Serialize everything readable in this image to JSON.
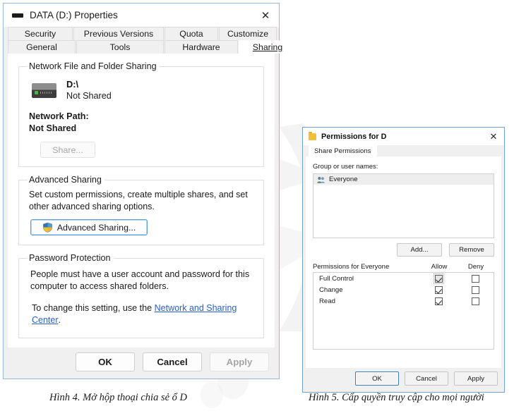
{
  "properties_dialog": {
    "title": "DATA (D:) Properties",
    "icon": "hard-drive-icon",
    "close_label": "✕",
    "tabs_row1": [
      {
        "label": "Security",
        "selected": false
      },
      {
        "label": "Previous Versions",
        "selected": false
      },
      {
        "label": "Quota",
        "selected": false
      },
      {
        "label": "Customize",
        "selected": false
      }
    ],
    "tabs_row2": [
      {
        "label": "General",
        "selected": false
      },
      {
        "label": "Tools",
        "selected": false
      },
      {
        "label": "Hardware",
        "selected": false
      },
      {
        "label": "Sharing",
        "selected": true
      }
    ],
    "network_sharing": {
      "legend": "Network File and Folder Sharing",
      "drive_path": "D:\\",
      "drive_state": "Not Shared",
      "network_path_label": "Network Path:",
      "network_path_value": "Not Shared",
      "share_button": "Share..."
    },
    "advanced_sharing": {
      "legend": "Advanced Sharing",
      "description": "Set custom permissions, create multiple shares, and set other advanced sharing options.",
      "button": "Advanced Sharing..."
    },
    "password_protection": {
      "legend": "Password Protection",
      "line1": "People must have a user account and password for this",
      "line2": "computer to access shared folders.",
      "line3_prefix": "To change this setting, use the ",
      "link": "Network and Sharing Center",
      "line3_suffix": "."
    },
    "footer": {
      "ok": "OK",
      "cancel": "Cancel",
      "apply": "Apply",
      "apply_disabled": true
    }
  },
  "permissions_dialog": {
    "title": "Permissions for D",
    "icon": "folder-icon",
    "close_label": "✕",
    "tabs": [
      {
        "label": "Share Permissions",
        "selected": true
      }
    ],
    "group_label": "Group or user names:",
    "group_items": [
      {
        "name": "Everyone",
        "icon": "people-icon",
        "selected": true
      }
    ],
    "add_button": "Add...",
    "remove_button": "Remove",
    "permissions_header": "Permissions for Everyone",
    "col_allow": "Allow",
    "col_deny": "Deny",
    "permissions": [
      {
        "name": "Full Control",
        "allow": true,
        "deny": false,
        "allow_dimmed": true
      },
      {
        "name": "Change",
        "allow": true,
        "deny": false,
        "allow_dimmed": false
      },
      {
        "name": "Read",
        "allow": true,
        "deny": false,
        "allow_dimmed": false
      }
    ],
    "footer": {
      "ok": "OK",
      "cancel": "Cancel",
      "apply": "Apply"
    }
  },
  "captions": {
    "left": "Hình 4. Mở hộp thoại chia sẻ ổ D",
    "right": "Hình 5. Cấp quyền truy cập cho mọi người"
  },
  "colors": {
    "accent": "#2a62c4",
    "dialog_border": "#9cb8d6",
    "led_green": "#35c13a",
    "folder_yellow": "#f2c037"
  }
}
